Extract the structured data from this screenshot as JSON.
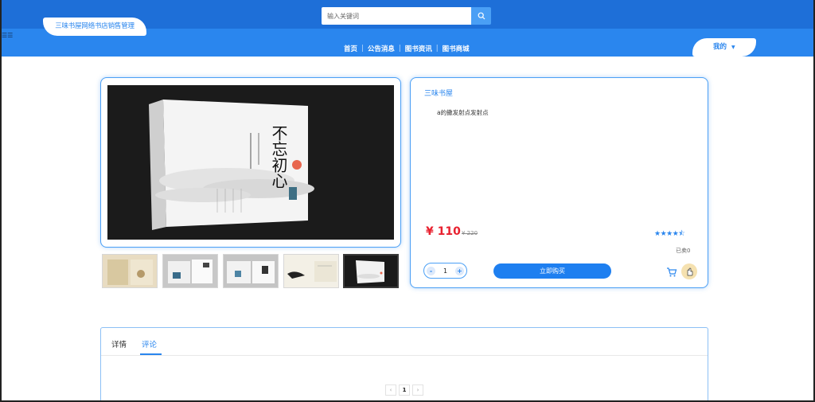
{
  "header": {
    "site_title": "三味书屋网络书店销售管理",
    "search_placeholder": "输入关键词",
    "nav": [
      "首页",
      "公告消息",
      "图书资讯",
      "图书商城"
    ],
    "user_menu": "我的"
  },
  "product": {
    "shop_name": "三味书屋",
    "description": "a的撒发射点发射点",
    "price": "¥ 110",
    "original_price": "¥ 220",
    "rating_stars": "★★★★⯪",
    "sold": "已卖0",
    "quantity": "1",
    "buy_label": "立即购买",
    "cover_title": "不忘初心"
  },
  "tabs": {
    "detail": "详情",
    "reviews": "评论",
    "active": "评论"
  },
  "pagination": {
    "prev": "‹",
    "current": "1",
    "next": "›"
  },
  "colors": {
    "primary": "#2a86ee",
    "header_dark": "#1e6fd8",
    "price": "#e8212f"
  }
}
